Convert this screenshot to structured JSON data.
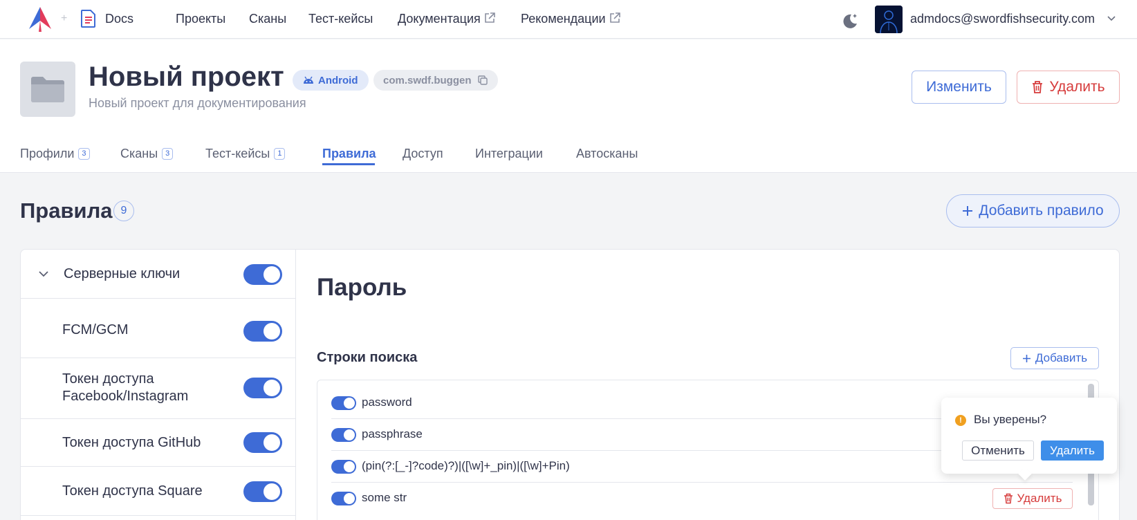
{
  "nav": {
    "app_name": "Docs",
    "links": [
      "Проекты",
      "Сканы",
      "Тест-кейсы",
      "Документация",
      "Рекомендации"
    ],
    "user_email": "admdocs@swordfishsecurity.com"
  },
  "project": {
    "title": "Новый проект",
    "platform": "Android",
    "package": "com.swdf.buggen",
    "subtitle": "Новый проект для документирования",
    "edit_label": "Изменить",
    "delete_label": "Удалить"
  },
  "tabs": [
    {
      "label": "Профили",
      "count": "3"
    },
    {
      "label": "Сканы",
      "count": "3"
    },
    {
      "label": "Тест-кейсы",
      "count": "1"
    },
    {
      "label": "Правила",
      "count": ""
    },
    {
      "label": "Доступ",
      "count": ""
    },
    {
      "label": "Интеграции",
      "count": ""
    },
    {
      "label": "Автосканы",
      "count": ""
    }
  ],
  "active_tab": "Правила",
  "rules": {
    "title": "Правила",
    "count": "9",
    "add_label": "Добавить правило",
    "group": {
      "label": "Серверные ключи",
      "enabled": true
    },
    "items": [
      {
        "label": "FCM/GCM",
        "enabled": true
      },
      {
        "label": "Токен доступа Facebook/Instagram",
        "enabled": true
      },
      {
        "label": "Токен доступа GitHub",
        "enabled": true
      },
      {
        "label": "Токен доступа Square",
        "enabled": true
      }
    ]
  },
  "detail": {
    "name": "Пароль",
    "search_title": "Строки поиска",
    "add_label": "Добавить",
    "strings": [
      {
        "text": "password",
        "enabled": true
      },
      {
        "text": "passphrase",
        "enabled": true
      },
      {
        "text": "(pin(?:[_-]?code)?)|([\\w]+_pin)|([\\w]+Pin)",
        "enabled": true
      },
      {
        "text": "some str",
        "enabled": true
      }
    ],
    "row_delete_label": "Удалить"
  },
  "popconfirm": {
    "message": "Вы уверены?",
    "cancel_label": "Отменить",
    "ok_label": "Удалить"
  },
  "colors": {
    "accent": "#3e6bd6",
    "danger": "#d63b3b",
    "warning": "#f0a020"
  }
}
